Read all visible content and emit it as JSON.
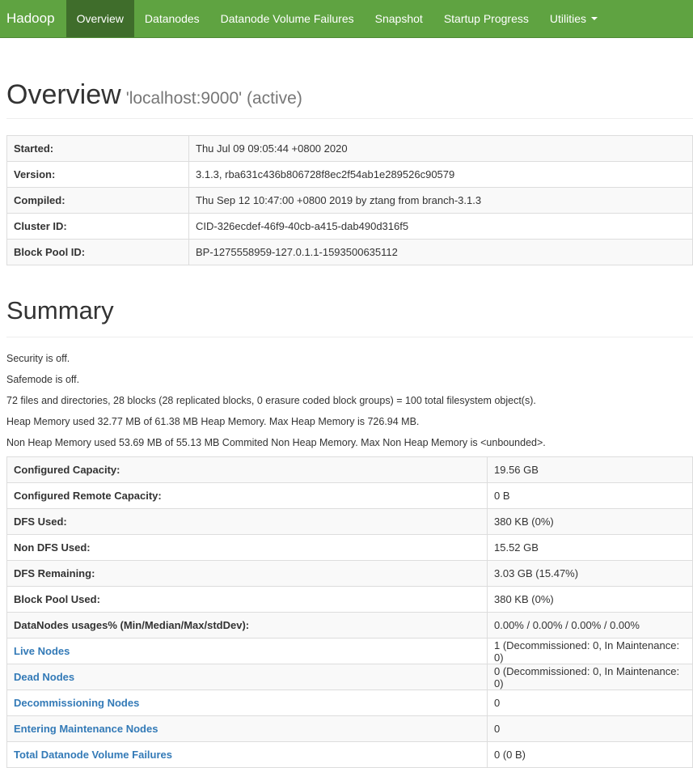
{
  "navbar": {
    "brand": "Hadoop",
    "items": [
      {
        "label": "Overview"
      },
      {
        "label": "Datanodes"
      },
      {
        "label": "Datanode Volume Failures"
      },
      {
        "label": "Snapshot"
      },
      {
        "label": "Startup Progress"
      },
      {
        "label": "Utilities"
      }
    ]
  },
  "overview": {
    "title": "Overview",
    "subtitle": "'localhost:9000' (active)",
    "rows": [
      {
        "label": "Started:",
        "value": "Thu Jul 09 09:05:44 +0800 2020"
      },
      {
        "label": "Version:",
        "value": "3.1.3, rba631c436b806728f8ec2f54ab1e289526c90579"
      },
      {
        "label": "Compiled:",
        "value": "Thu Sep 12 10:47:00 +0800 2019 by ztang from branch-3.1.3"
      },
      {
        "label": "Cluster ID:",
        "value": "CID-326ecdef-46f9-40cb-a415-dab490d316f5"
      },
      {
        "label": "Block Pool ID:",
        "value": "BP-1275558959-127.0.1.1-1593500635112"
      }
    ]
  },
  "summary": {
    "title": "Summary",
    "lines": [
      "Security is off.",
      "Safemode is off.",
      "72 files and directories, 28 blocks (28 replicated blocks, 0 erasure coded block groups) = 100 total filesystem object(s).",
      "Heap Memory used 32.77 MB of 61.38 MB Heap Memory. Max Heap Memory is 726.94 MB.",
      "Non Heap Memory used 53.69 MB of 55.13 MB Commited Non Heap Memory. Max Non Heap Memory is <unbounded>."
    ],
    "rows": [
      {
        "label": "Configured Capacity:",
        "value": "19.56 GB"
      },
      {
        "label": "Configured Remote Capacity:",
        "value": "0 B"
      },
      {
        "label": "DFS Used:",
        "value": "380 KB (0%)"
      },
      {
        "label": "Non DFS Used:",
        "value": "15.52 GB"
      },
      {
        "label": "DFS Remaining:",
        "value": "3.03 GB (15.47%)"
      },
      {
        "label": "Block Pool Used:",
        "value": "380 KB (0%)"
      },
      {
        "label": "DataNodes usages% (Min/Median/Max/stdDev):",
        "value": "0.00% / 0.00% / 0.00% / 0.00%"
      },
      {
        "label": "Live Nodes",
        "value": "1 (Decommissioned: 0, In Maintenance: 0)"
      },
      {
        "label": "Dead Nodes",
        "value": "0 (Decommissioned: 0, In Maintenance: 0)"
      },
      {
        "label": "Decommissioning Nodes",
        "value": "0"
      },
      {
        "label": "Entering Maintenance Nodes",
        "value": "0"
      },
      {
        "label": "Total Datanode Volume Failures",
        "value": "0 (0 B)"
      }
    ]
  },
  "colors": {
    "navbar_bg": "#5fa341",
    "navbar_active": "#3f6d2b",
    "link": "#337ab7"
  }
}
